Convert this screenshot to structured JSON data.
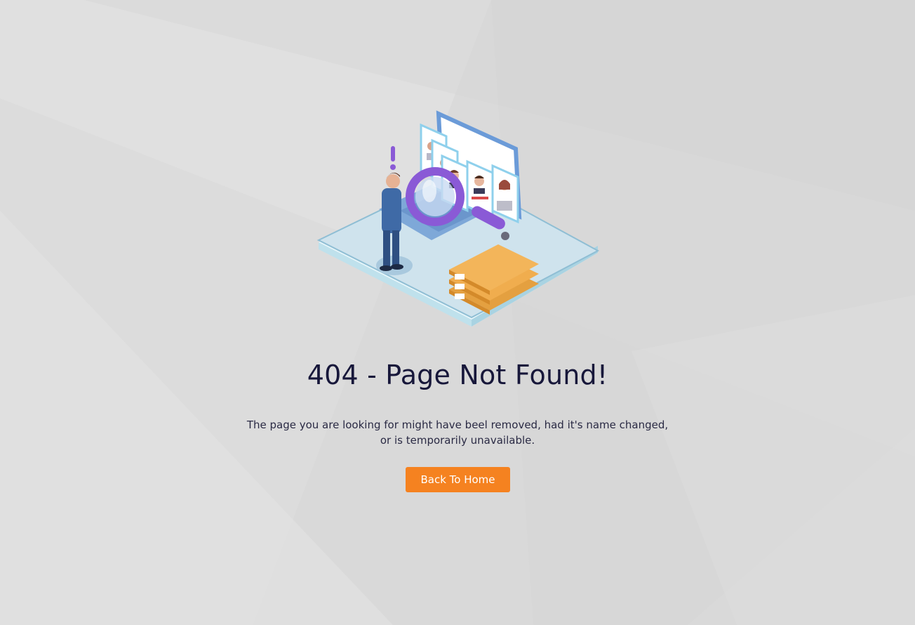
{
  "error": {
    "title": "404 - Page Not Found!",
    "description_line1": "The page you are looking for might have beel removed, had it's name changed,",
    "description_line2": "or is temporarily unavailable."
  },
  "actions": {
    "back_home_label": "Back To Home"
  },
  "illustration": {
    "icon": "search-profiles-illustration"
  },
  "colors": {
    "background": "#dcdcdc",
    "title": "#17173a",
    "text": "#2a2a44",
    "button": "#f58220",
    "button_text": "#ffffff"
  }
}
